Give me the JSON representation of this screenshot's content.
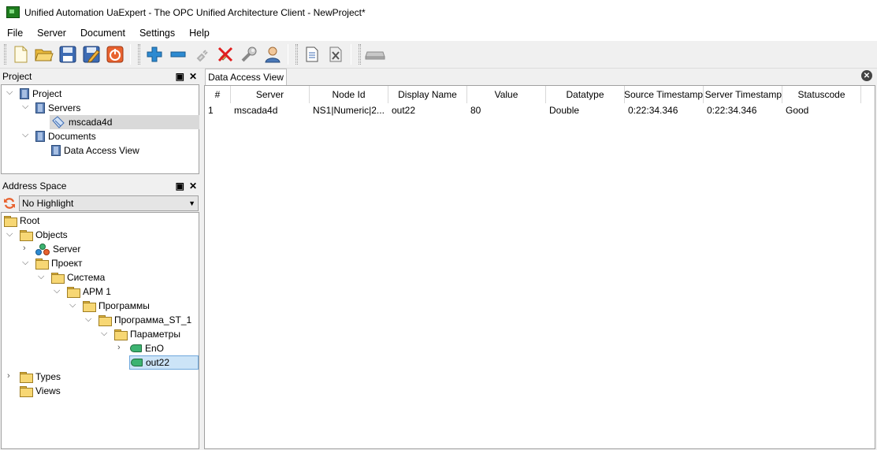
{
  "window": {
    "title": "Unified Automation UaExpert - The OPC Unified Architecture Client - NewProject*"
  },
  "menu": [
    "File",
    "Server",
    "Document",
    "Settings",
    "Help"
  ],
  "project_panel": {
    "title": "Project",
    "items": {
      "project": "Project",
      "servers": "Servers",
      "server": "mscada4d",
      "documents": "Documents",
      "dav": "Data Access View"
    }
  },
  "address_panel": {
    "title": "Address Space",
    "highlight": "No Highlight",
    "items": {
      "root": "Root",
      "objects": "Objects",
      "server": "Server",
      "project": "Проект",
      "system": "Система",
      "arm": "АРМ 1",
      "programs": "Программы",
      "program": "Программа_ST_1",
      "params": "Параметры",
      "eno": "EnO",
      "out22": "out22",
      "types": "Types",
      "views": "Views"
    }
  },
  "tab": {
    "label": "Data Access View"
  },
  "table": {
    "headers": [
      "#",
      "Server",
      "Node Id",
      "Display Name",
      "Value",
      "Datatype",
      "Source Timestamp",
      "Server Timestamp",
      "Statuscode"
    ],
    "rows": [
      [
        "1",
        "mscada4d",
        "NS1|Numeric|2...",
        "out22",
        "80",
        "Double",
        "0:22:34.346",
        "0:22:34.346",
        "Good"
      ]
    ]
  }
}
